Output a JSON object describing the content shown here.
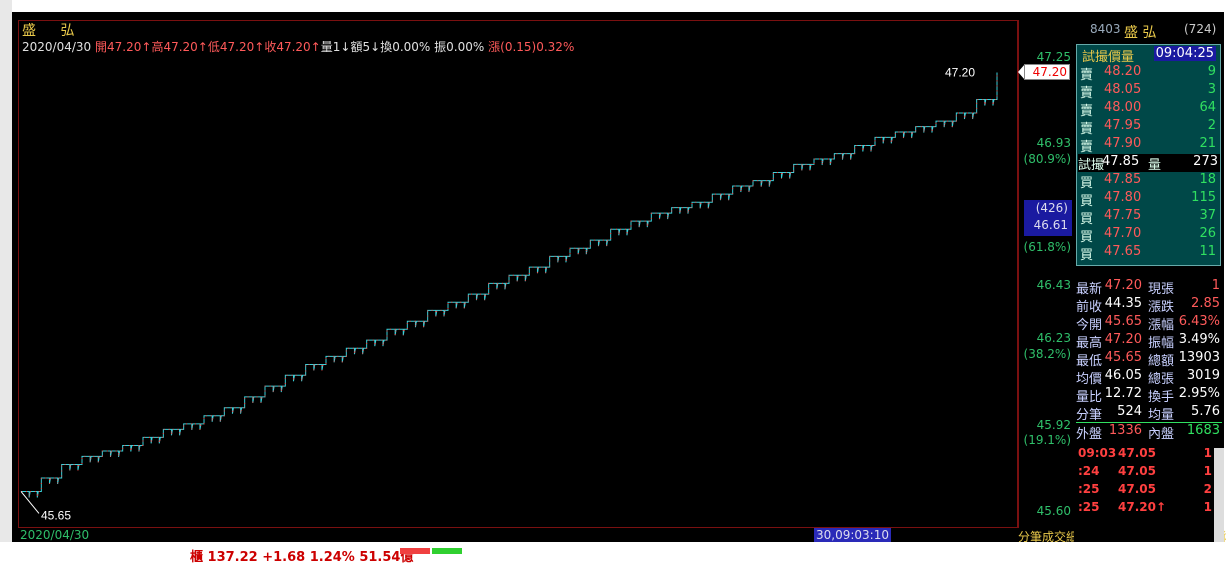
{
  "stock": {
    "name": "盛    弘",
    "code": "8403",
    "header_name": "盛  弘",
    "header_count": "(724)"
  },
  "info": {
    "date": "2020/04/30",
    "open_lbl": "開",
    "open": "47.20↑",
    "high_lbl": "高",
    "high": "47.20↑",
    "low_lbl": "低",
    "low": "47.20↑",
    "close_lbl": "收",
    "close": "47.20↑",
    "vol_lbl": "量",
    "vol": "1↓",
    "amt_lbl": "額",
    "amt": "5↓",
    "turn_lbl": "換",
    "turn": "0.00%",
    "amp_lbl": "振",
    "amp": "0.00%",
    "chg_lbl": "漲",
    "chg": "(0.15)0.32%"
  },
  "axis": {
    "prices": [
      "47.25",
      "46.93",
      "46.61",
      "46.43",
      "46.23",
      "45.92",
      "45.60"
    ],
    "pcts": [
      "(80.9%)",
      "(61.8%)",
      "(38.2%)",
      "(19.1%)"
    ],
    "current": "47.20",
    "blue_count": "(426)",
    "blue_price": "46.61"
  },
  "chart_data": {
    "type": "line",
    "ylim": [
      45.6,
      47.25
    ],
    "start_label": "45.65",
    "end_label": "47.20",
    "x_start": "2020/04/30",
    "cursor_time": "30,09:03:10",
    "series": [
      {
        "values": [
          45.65,
          45.7,
          45.75,
          45.78,
          45.8,
          45.82,
          45.85,
          45.88,
          45.9,
          45.93,
          45.96,
          46.0,
          46.04,
          46.08,
          46.12,
          46.15,
          46.18,
          46.21,
          46.25,
          46.28,
          46.32,
          46.35,
          46.38,
          46.42,
          46.45,
          46.48,
          46.52,
          46.55,
          46.58,
          46.62,
          46.65,
          46.68,
          46.7,
          46.72,
          46.75,
          46.78,
          46.8,
          46.83,
          46.86,
          46.88,
          46.9,
          46.93,
          46.96,
          46.98,
          47.0,
          47.02,
          47.05,
          47.1,
          47.2
        ]
      }
    ]
  },
  "orderbook": {
    "header": "試撮價量",
    "time": "09:04:25",
    "asks": [
      {
        "label": "賣",
        "price": "48.20",
        "qty": "9"
      },
      {
        "label": "賣",
        "price": "48.05",
        "qty": "3"
      },
      {
        "label": "賣",
        "price": "48.00",
        "qty": "64"
      },
      {
        "label": "賣",
        "price": "47.95",
        "qty": "2"
      },
      {
        "label": "賣",
        "price": "47.90",
        "qty": "21"
      }
    ],
    "trial": {
      "label": "試撮",
      "price": "47.85",
      "qty_label": "量",
      "qty": "273"
    },
    "bids": [
      {
        "label": "買",
        "price": "47.85",
        "qty": "18"
      },
      {
        "label": "買",
        "price": "47.80",
        "qty": "115"
      },
      {
        "label": "買",
        "price": "47.75",
        "qty": "37"
      },
      {
        "label": "買",
        "price": "47.70",
        "qty": "26"
      },
      {
        "label": "買",
        "price": "47.65",
        "qty": "11"
      }
    ]
  },
  "stats": [
    {
      "l1": "最新",
      "v1": "47.20",
      "l2": "現張",
      "v2": "1"
    },
    {
      "l1": "前收",
      "v1": "44.35",
      "l2": "漲跌",
      "v2": "2.85"
    },
    {
      "l1": "今開",
      "v1": "45.65",
      "l2": "漲幅",
      "v2": "6.43%"
    },
    {
      "l1": "最高",
      "v1": "47.20",
      "l2": "振幅",
      "v2": "3.49%"
    },
    {
      "l1": "最低",
      "v1": "45.65",
      "l2": "總額",
      "v2": "13903"
    },
    {
      "l1": "均價",
      "v1": "46.05",
      "l2": "總張",
      "v2": "3019"
    },
    {
      "l1": "量比",
      "v1": "12.72",
      "l2": "換手",
      "v2": "2.95%"
    },
    {
      "l1": "分筆",
      "v1": "524",
      "l2": "均量",
      "v2": "5.76"
    },
    {
      "l1": "外盤",
      "v1": "1336",
      "l2": "內盤",
      "v2": "1683"
    }
  ],
  "ticks": [
    {
      "time": "09:03",
      "price": "47.05",
      "qty": "1"
    },
    {
      "time": ":24",
      "price": "47.05",
      "qty": "1"
    },
    {
      "time": ":25",
      "price": "47.05",
      "qty": "2"
    },
    {
      "time": ":25",
      "price": "47.20↑",
      "qty": "1"
    }
  ],
  "tabs": "分筆成交細價量表週指法人信用籌碼技術特解",
  "bottom": {
    "index": "櫃  137.22 +1.68  1.24%  51.54億"
  }
}
